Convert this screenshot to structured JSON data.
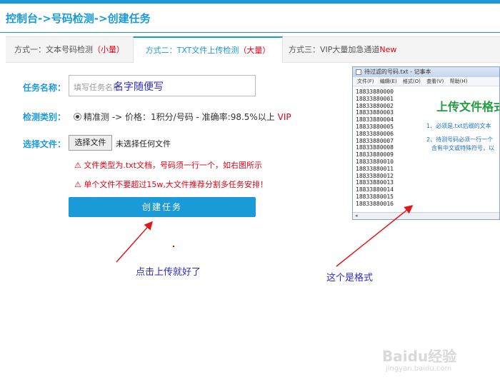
{
  "breadcrumb": "控制台->号码检测->创建任务",
  "tabs": {
    "tab1_prefix": "方式一：文本号码检测",
    "tab1_badge": "（小量）",
    "tab2_prefix": "方式二：TXT文件上传检测",
    "tab2_badge": "（大量）",
    "tab3_prefix": "方式三：VIP大量加急通道",
    "tab3_badge": "New"
  },
  "form": {
    "task_name_label": "任务名称：",
    "task_name_placeholder": "填写任务名称",
    "task_name_handwritten": "名字随便写",
    "check_type_label": "检测类别：",
    "check_type_option": "精准测 -> 价格：1积分/号码 - 准确率:98.5%以上",
    "check_type_vip": "VIP",
    "file_label": "选择文件：",
    "file_button": "选择文件",
    "file_none": "未选择任何文件",
    "warn1": "⚠ 文件类型为.txt文档，号码须一行一个，如右图所示",
    "warn2": "⚠ 单个文件不要超过15w,大文件推荐分割多任务安排！",
    "create_button": "创建任务"
  },
  "annotations": {
    "click_upload": "点击上传就好了",
    "this_is_format": "这个是格式"
  },
  "notepad": {
    "title": "待过滤的号码.txt - 记事本",
    "menu": [
      "文件(F)",
      "编辑(E)",
      "格式(O)",
      "查看(V)",
      "帮助(H)"
    ],
    "lines": [
      "18833880000",
      "18833880001",
      "18833880002",
      "18833880003",
      "18833880004",
      "18833880005",
      "18833880006",
      "18833880007",
      "18833880008",
      "18833880009",
      "18833880010",
      "18833880011",
      "18833880012",
      "18833880013",
      "18833880014",
      "18833880015",
      "18833880016"
    ],
    "heading": "上传文件格式",
    "note1": "1、必须是.txt后缀的文本",
    "note2": "2、待测号码必须一行一个",
    "note3": "含有中文或特殊符号，以"
  },
  "watermark": {
    "brand": "Baidu经验",
    "url": "jingyan.baidu.com"
  },
  "colors": {
    "accent": "#1a9ad9",
    "warning": "#e60012",
    "annotation": "#2a2ad0",
    "arrow": "#e01818"
  }
}
